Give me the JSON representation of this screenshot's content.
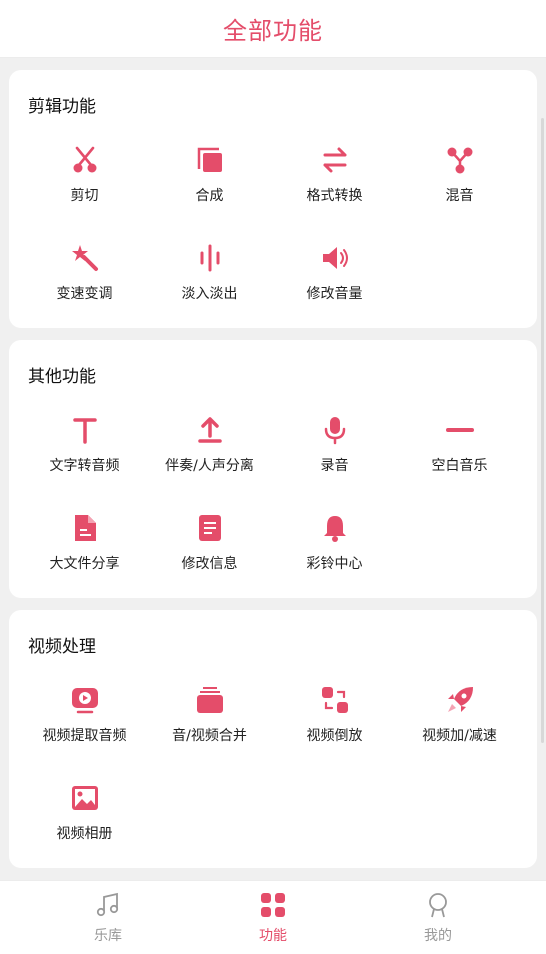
{
  "header": {
    "title": "全部功能"
  },
  "accent": "#e44d6a",
  "sections": [
    {
      "title": "剪辑功能",
      "items": [
        {
          "label": "剪切",
          "icon": "scissors-icon"
        },
        {
          "label": "合成",
          "icon": "copy-stack-icon"
        },
        {
          "label": "格式转换",
          "icon": "swap-arrows-icon"
        },
        {
          "label": "混音",
          "icon": "merge-icon"
        },
        {
          "label": "变速变调",
          "icon": "magic-wand-icon"
        },
        {
          "label": "淡入淡出",
          "icon": "waveform-icon"
        },
        {
          "label": "修改音量",
          "icon": "volume-icon"
        }
      ]
    },
    {
      "title": "其他功能",
      "items": [
        {
          "label": "文字转音频",
          "icon": "text-icon"
        },
        {
          "label": "伴奏/人声分离",
          "icon": "upload-icon"
        },
        {
          "label": "录音",
          "icon": "microphone-icon"
        },
        {
          "label": "空白音乐",
          "icon": "minus-icon"
        },
        {
          "label": "大文件分享",
          "icon": "file-icon"
        },
        {
          "label": "修改信息",
          "icon": "document-icon"
        },
        {
          "label": "彩铃中心",
          "icon": "bell-icon"
        }
      ]
    },
    {
      "title": "视频处理",
      "items": [
        {
          "label": "视频提取音频",
          "icon": "video-play-icon"
        },
        {
          "label": "音/视频合并",
          "icon": "stack-icon"
        },
        {
          "label": "视频倒放",
          "icon": "reverse-icon"
        },
        {
          "label": "视频加/减速",
          "icon": "rocket-icon"
        },
        {
          "label": "视频相册",
          "icon": "image-icon"
        }
      ]
    }
  ],
  "tabs": [
    {
      "label": "乐库",
      "icon": "music-note-icon",
      "active": false
    },
    {
      "label": "功能",
      "icon": "grid-icon",
      "active": true
    },
    {
      "label": "我的",
      "icon": "user-icon",
      "active": false
    }
  ]
}
